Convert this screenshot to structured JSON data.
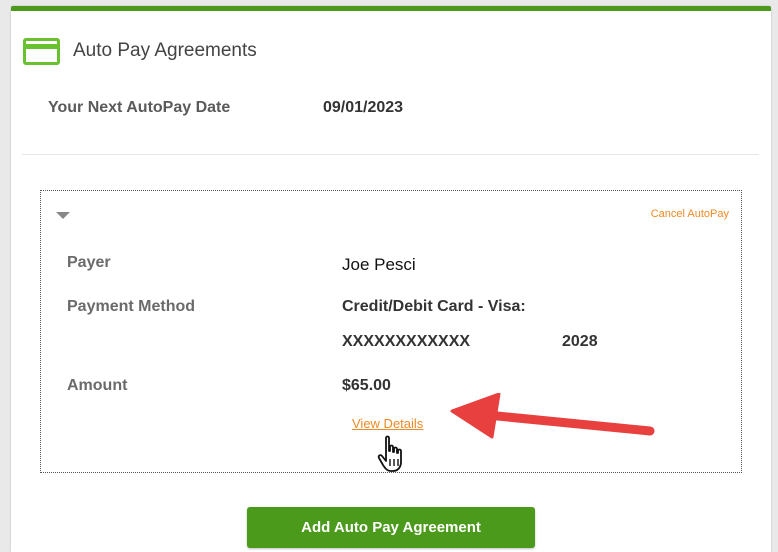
{
  "card": {
    "title": "Auto Pay Agreements",
    "icon": "credit-card-icon",
    "accent_color": "#4b9a1c"
  },
  "next_autopay": {
    "label": "Your Next AutoPay Date",
    "value": "09/01/2023"
  },
  "agreement": {
    "collapse_icon": "chevron-down-icon",
    "cancel_label": "Cancel AutoPay",
    "fields": {
      "payer_label": "Payer",
      "payer_value": "Joe Pesci",
      "method_label": "Payment Method",
      "method_value": "Credit/Debit Card - Visa:",
      "card_number": "XXXXXXXXXXXX",
      "card_expiry": "2028",
      "amount_label": "Amount",
      "amount_value": "$65.00"
    },
    "view_details_label": "View Details",
    "link_color": "#f08a24"
  },
  "actions": {
    "add_label": "Add Auto Pay Agreement"
  },
  "annotation": {
    "arrow_color": "#e8403f"
  }
}
